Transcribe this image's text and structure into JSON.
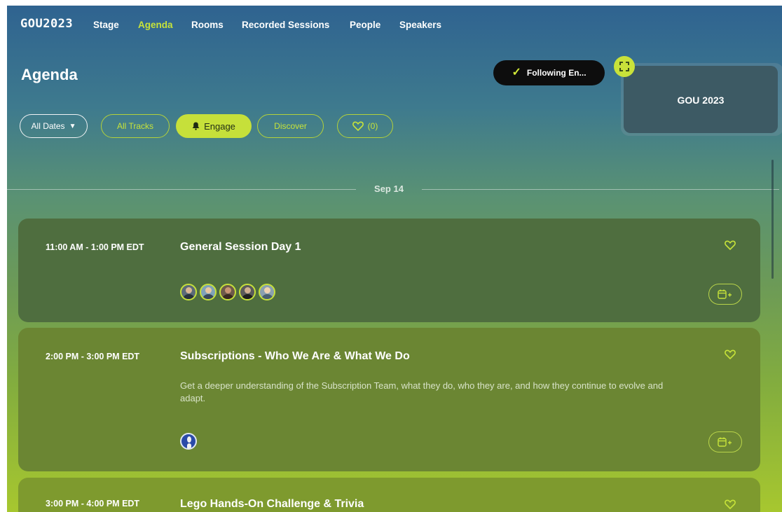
{
  "nav": {
    "logo": "GOU2023",
    "items": [
      "Stage",
      "Agenda",
      "Rooms",
      "Recorded Sessions",
      "People",
      "Speakers"
    ],
    "active": "Agenda"
  },
  "page": {
    "title": "Agenda",
    "follow_button": "Following En...",
    "mini_player_title": "GOU 2023"
  },
  "filters": {
    "dates": "All Dates",
    "tracks": "All Tracks",
    "engage": "Engage",
    "discover": "Discover",
    "favorites_count": "(0)"
  },
  "date_divider": "Sep 14",
  "sessions": [
    {
      "time": "11:00 AM - 1:00 PM EDT",
      "title": "General Session Day 1",
      "description": "",
      "speaker_count": 5
    },
    {
      "time": "2:00 PM - 3:00 PM EDT",
      "title": "Subscriptions - Who We Are & What We Do",
      "description": "Get a deeper understanding of the Subscription Team, what they do, who they are, and how they continue to evolve and adapt.",
      "speaker_count": 1
    },
    {
      "time": "3:00 PM - 4:00 PM EDT",
      "title": "Lego Hands-On Challenge & Trivia",
      "description": "",
      "speaker_count": 0
    }
  ],
  "colors": {
    "accent": "#c6e03a",
    "follow_bg": "#0d0d0d",
    "card_dark": "#4f6e3f",
    "card_mid": "#6b8633"
  },
  "icons": {
    "heart": "heart-outline-icon",
    "calendar_add": "calendar-plus-icon",
    "check": "check-icon",
    "bell": "bell-icon",
    "expand": "expand-icon",
    "caret": "caret-down-icon"
  }
}
